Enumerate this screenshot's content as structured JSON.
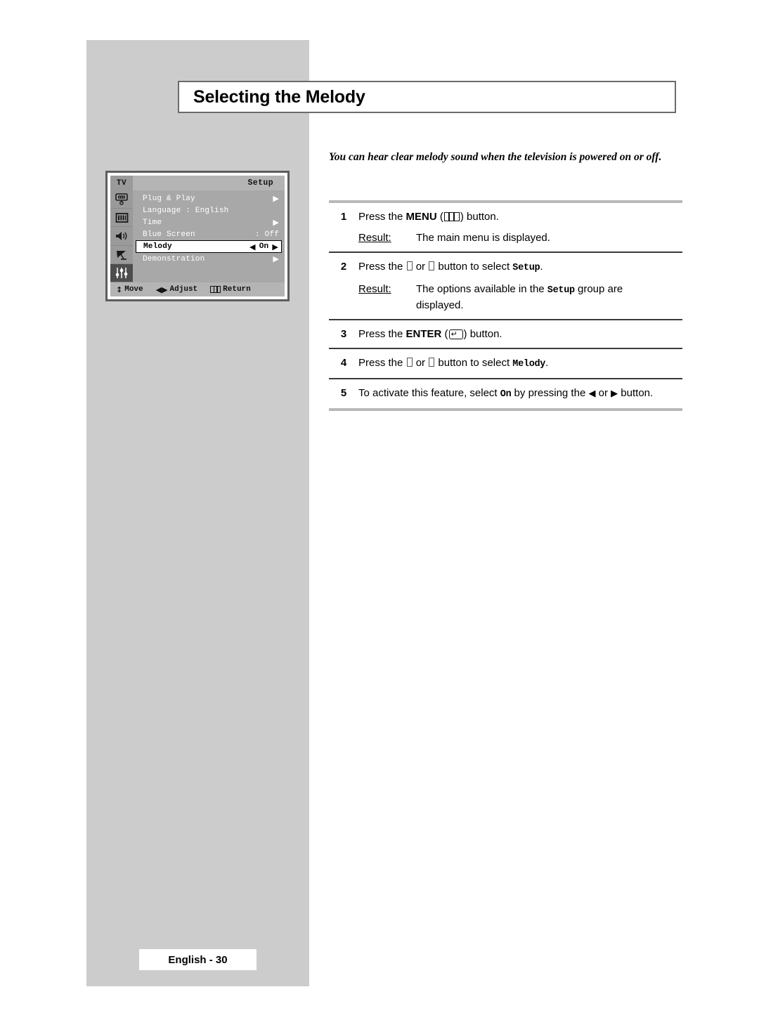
{
  "page": {
    "title": "Selecting the Melody",
    "intro": "You can hear clear melody sound when the television is powered on or off.",
    "footer_label": "English - 30"
  },
  "osd": {
    "tv_label": "TV",
    "group_title": "Setup",
    "icons": [
      {
        "name": "monitor-icon",
        "active": false
      },
      {
        "name": "picture-bars-icon",
        "active": false
      },
      {
        "name": "speaker-icon",
        "active": false
      },
      {
        "name": "satellite-dish-icon",
        "active": false
      },
      {
        "name": "sliders-icon",
        "active": true
      }
    ],
    "rows": [
      {
        "label": "Plug & Play",
        "value": "",
        "arrow": "▶",
        "selected": false
      },
      {
        "label": "Language  : English",
        "value": "",
        "arrow": "",
        "selected": false
      },
      {
        "label": "Time",
        "value": "",
        "arrow": "▶",
        "selected": false
      },
      {
        "label": "Blue Screen",
        "value": ": Off",
        "arrow": "",
        "selected": false
      },
      {
        "label": "Melody",
        "value": "On",
        "left_arrow": "◀",
        "right_arrow": "▶",
        "selected": true
      },
      {
        "label": "Demonstration",
        "value": "",
        "arrow": "▶",
        "selected": false
      }
    ],
    "footer": [
      {
        "icon": "↕",
        "label": "Move"
      },
      {
        "icon": "◀▶",
        "label": "Adjust"
      },
      {
        "icon": "menu-icon",
        "label": "Return"
      }
    ]
  },
  "steps": [
    {
      "num": "1",
      "text_before": "Press the ",
      "bold": "MENU",
      "glyph": "menu-button-icon",
      "text_after": " button.",
      "result_label": "Result:",
      "result_text": "The main menu is displayed."
    },
    {
      "num": "2",
      "text_before": "Press the ",
      "glyph_a": "missing-box-glyph",
      "text_mid": " or ",
      "glyph_b": "missing-box-glyph",
      "text_after": " button to select ",
      "mono": "Setup",
      "text_end": ".",
      "result_label": "Result:",
      "result_text_a": "The options available in the ",
      "result_mono": "Setup",
      "result_text_b": " group are",
      "result_text_c": "displayed."
    },
    {
      "num": "3",
      "text_before": "Press the ",
      "bold": "ENTER",
      "glyph": "enter-button-icon",
      "text_after": " button."
    },
    {
      "num": "4",
      "text_before": "Press the ",
      "glyph_a": "missing-box-glyph",
      "text_mid": " or ",
      "glyph_b": "missing-box-glyph",
      "text_after": " button to select ",
      "mono": "Melody",
      "text_end": "."
    },
    {
      "num": "5",
      "text_before": "To activate this feature, select ",
      "mono": "On",
      "text_mid": " by pressing the ",
      "left_arrow": "◀",
      "text_or": " or ",
      "right_arrow": "▶",
      "text_after": " button."
    }
  ]
}
